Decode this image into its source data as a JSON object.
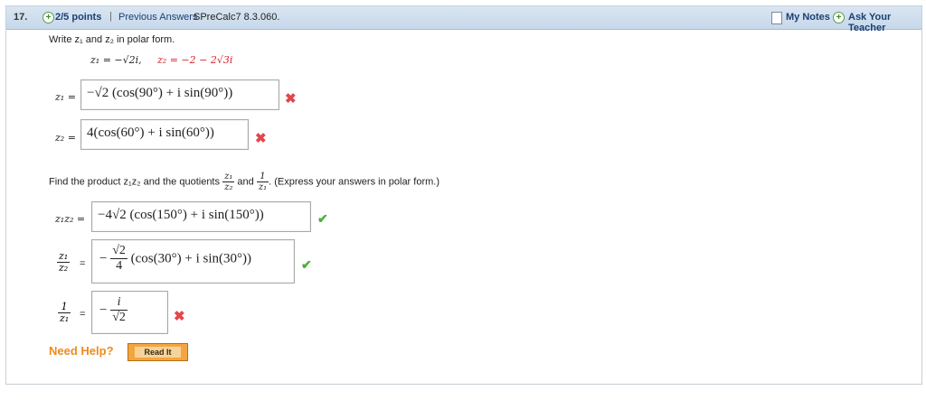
{
  "header": {
    "number": "17.",
    "points": "2/5 points",
    "separator": "|",
    "previous_answers": "Previous Answers",
    "source": "SPreCalc7 8.3.060.",
    "my_notes": "My Notes",
    "ask_teacher": "Ask Your Teacher",
    "plus_glyph": "+"
  },
  "prompt": {
    "line1": "Write z₁ and z₂ in polar form.",
    "given_z1": "z₁ = −√2i,",
    "given_z2": "z₂ = −2 − 2√3i"
  },
  "answers": {
    "z1_label": "z₁ =",
    "z1_value": "−√2 (cos(90°) + i sin(90°))",
    "z1_status": "incorrect",
    "z2_label": "z₂ =",
    "z2_value": "4(cos(60°) + i sin(60°))",
    "z2_status": "incorrect"
  },
  "part2": {
    "instr_pre": "Find the product z₁z₂ and the quotients",
    "instr_frac1_num": "z₁",
    "instr_frac1_den": "z₂",
    "instr_and": "and",
    "instr_frac2_num": "1",
    "instr_frac2_den": "z₁",
    "instr_post": ". (Express your answers in polar form.)",
    "product_label": "z₁z₂ =",
    "product_value": "−4√2 (cos(150°) + i sin(150°))",
    "product_status": "correct",
    "quot_label_num": "z₁",
    "quot_label_den": "z₂",
    "quot_eq": "=",
    "quot_minus": "−",
    "quot_frac_num": "√2",
    "quot_frac_den": "4",
    "quot_rest": "(cos(30°) + i sin(30°))",
    "quot_status": "correct",
    "recip_label_num": "1",
    "recip_label_den": "z₁",
    "recip_eq": "=",
    "recip_minus": "−",
    "recip_frac_num": "i",
    "recip_frac_den": "√2",
    "recip_status": "incorrect"
  },
  "marks": {
    "wrong": "✖",
    "right": "✔"
  },
  "help": {
    "need_help": "Need Help?",
    "read_it": "Read It"
  },
  "colors": {
    "header_bg": "#c6d8ea",
    "link": "#1b3f73",
    "wrong": "#e0474c",
    "right": "#4caf36",
    "help": "#f08a1c"
  }
}
